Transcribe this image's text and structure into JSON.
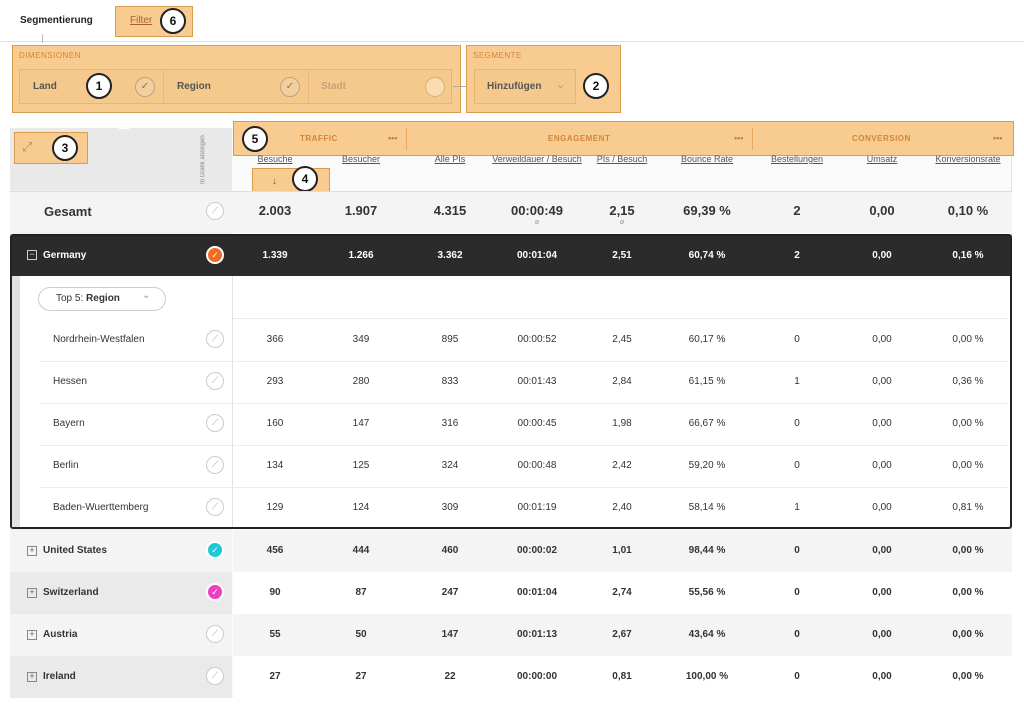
{
  "tabs": {
    "segmentierung": "Segmentierung",
    "filter": "Filter"
  },
  "callouts": [
    "1",
    "2",
    "3",
    "4",
    "5",
    "6"
  ],
  "dimensions": {
    "title": "DIMENSIONEN",
    "items": [
      {
        "label": "Land",
        "state": "checked"
      },
      {
        "label": "Region",
        "state": "checked"
      },
      {
        "label": "Stadt",
        "state": "empty"
      }
    ]
  },
  "segments": {
    "title": "SEGMENTE",
    "add_label": "Hinzufügen"
  },
  "chart_toggle_label": "In Grafik anzeigen",
  "groups": [
    {
      "label": "TRAFFIC",
      "dots": "•••"
    },
    {
      "label": "ENGAGEMENT",
      "dots": "•••"
    },
    {
      "label": "CONVERSION",
      "dots": "•••"
    }
  ],
  "columns": [
    "Besuche",
    "Besucher",
    "Alle PIs",
    "Verweildauer / Besuch",
    "PIs / Besuch",
    "Bounce Rate",
    "Bestellungen",
    "Umsatz",
    "Konversionsrate"
  ],
  "sort_arrow": "↓",
  "total": {
    "label": "Gesamt",
    "values": [
      "2.003",
      "1.907",
      "4.315",
      "00:00:49",
      "2,15",
      "69,39 %",
      "2",
      "0,00",
      "0,10 %"
    ],
    "avg_mark": "ø"
  },
  "germany": {
    "label": "Germany",
    "values": [
      "1.339",
      "1.266",
      "3.362",
      "00:01:04",
      "2,51",
      "60,74 %",
      "2",
      "0,00",
      "0,16 %"
    ],
    "top5_prefix": "Top 5: ",
    "top5_value": "Region",
    "regions": [
      {
        "label": "Nordrhein-Westfalen",
        "values": [
          "366",
          "349",
          "895",
          "00:00:52",
          "2,45",
          "60,17 %",
          "0",
          "0,00",
          "0,00 %"
        ]
      },
      {
        "label": "Hessen",
        "values": [
          "293",
          "280",
          "833",
          "00:01:43",
          "2,84",
          "61,15 %",
          "1",
          "0,00",
          "0,36 %"
        ]
      },
      {
        "label": "Bayern",
        "values": [
          "160",
          "147",
          "316",
          "00:00:45",
          "1,98",
          "66,67 %",
          "0",
          "0,00",
          "0,00 %"
        ]
      },
      {
        "label": "Berlin",
        "values": [
          "134",
          "125",
          "324",
          "00:00:48",
          "2,42",
          "59,20 %",
          "0",
          "0,00",
          "0,00 %"
        ]
      },
      {
        "label": "Baden-Wuerttemberg",
        "values": [
          "129",
          "124",
          "309",
          "00:01:19",
          "2,40",
          "58,14 %",
          "1",
          "0,00",
          "0,81 %"
        ]
      }
    ]
  },
  "countries": [
    {
      "label": "United States",
      "check_color": "#1ec8d8",
      "values": [
        "456",
        "444",
        "460",
        "00:00:02",
        "1,01",
        "98,44 %",
        "0",
        "0,00",
        "0,00 %"
      ]
    },
    {
      "label": "Switzerland",
      "check_color": "#ee3fbf",
      "values": [
        "90",
        "87",
        "247",
        "00:01:04",
        "2,74",
        "55,56 %",
        "0",
        "0,00",
        "0,00 %"
      ]
    },
    {
      "label": "Austria",
      "check_color": "",
      "values": [
        "55",
        "50",
        "147",
        "00:01:13",
        "2,67",
        "43,64 %",
        "0",
        "0,00",
        "0,00 %"
      ]
    },
    {
      "label": "Ireland",
      "check_color": "",
      "values": [
        "27",
        "27",
        "22",
        "00:00:00",
        "0,81",
        "100,00 %",
        "0",
        "0,00",
        "0,00 %"
      ]
    }
  ],
  "colors": {
    "accent_orange": "#f26c20",
    "highlight": "#f8cc91"
  }
}
